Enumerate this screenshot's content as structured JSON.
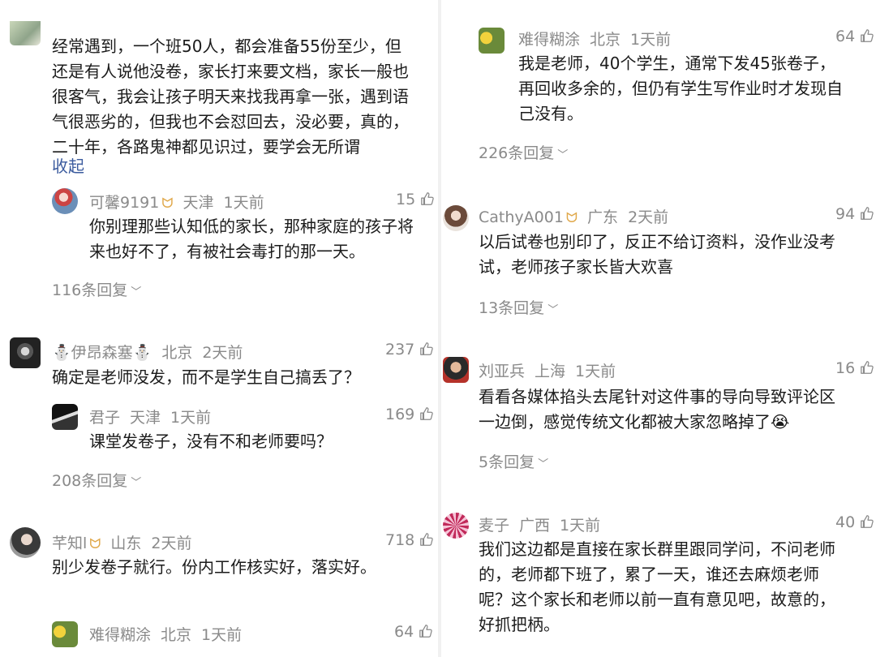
{
  "left": {
    "top_comment": {
      "lines": [
        "经常遇到，一个班50人，都会准备55份至少，但",
        "还是有人说他没卷，家长打来要文档，家长一般也",
        "很客气，我会让孩子明天来找我再拿一张，遇到语",
        "气很恶劣的，但我也不会怼回去，没必要，真的，",
        "二十年，各路鬼神都见识过，要学会无所谓"
      ],
      "collapse_label": "收起"
    },
    "reply_1": {
      "user": "可馨9191",
      "badge": "ᗢ",
      "location": "天津",
      "time": "1天前",
      "likes": "15",
      "lines": [
        "你别理那些认知低的家长，那种家庭的孩子将",
        "来也好不了，有被社会毒打的那一天。"
      ]
    },
    "replies_1": "116条回复",
    "comment_2": {
      "user": "⛄伊昂森塞⛄",
      "location": "北京",
      "time": "2天前",
      "likes": "237",
      "lines": [
        "确定是老师没发，而不是学生自己搞丢了？"
      ]
    },
    "reply_2": {
      "user": "君子",
      "location": "天津",
      "time": "1天前",
      "likes": "169",
      "lines": [
        "课堂发卷子，没有不和老师要吗？"
      ]
    },
    "replies_2": "208条回复",
    "comment_3": {
      "user": "芊知l",
      "badge": "ᗢ",
      "location": "山东",
      "time": "2天前",
      "likes": "718",
      "lines": [
        "别少发卷子就行。份内工作核实好，落实好。"
      ]
    },
    "comment_4": {
      "user": "难得糊涂",
      "location": "北京",
      "time": "1天前",
      "likes": "64"
    }
  },
  "right": {
    "comment_1": {
      "user": "难得糊涂",
      "location": "北京",
      "time": "1天前",
      "likes": "64",
      "lines": [
        "我是老师，40个学生，通常下发45张卷子，",
        "再回收多余的，但仍有学生写作业时才发现自",
        "己没有。"
      ]
    },
    "replies_1": "226条回复",
    "comment_2": {
      "user": "CathyA001",
      "badge": "ᗢ",
      "location": "广东",
      "time": "2天前",
      "likes": "94",
      "lines": [
        "以后试卷也别印了，反正不给订资料，没作业没考",
        "试，老师孩子家长皆大欢喜"
      ]
    },
    "replies_2": "13条回复",
    "comment_3": {
      "user": "刘亚兵",
      "location": "上海",
      "time": "1天前",
      "likes": "16",
      "lines": [
        "看看各媒体掐头去尾针对这件事的导向导致评论区",
        "一边倒，感觉传统文化都被大家忽略掉了😭"
      ]
    },
    "replies_3": "5条回复",
    "comment_4": {
      "user": "麦子",
      "location": "广西",
      "time": "1天前",
      "likes": "40",
      "lines": [
        "我们这边都是直接在家长群里跟同学问，不问老师",
        "的，老师都下班了，累了一天，谁还去麻烦老师",
        "呢？这个家长和老师以前一直有意见吧，故意的，",
        "好抓把柄。"
      ]
    }
  },
  "icons": {
    "like": "thumbs-up-icon",
    "expand": "chevron-down-icon"
  },
  "colors": {
    "meta": "#8a8a8a",
    "text": "#1b1b1b",
    "link": "#3b5b9e",
    "badge": "#e0a84a"
  }
}
